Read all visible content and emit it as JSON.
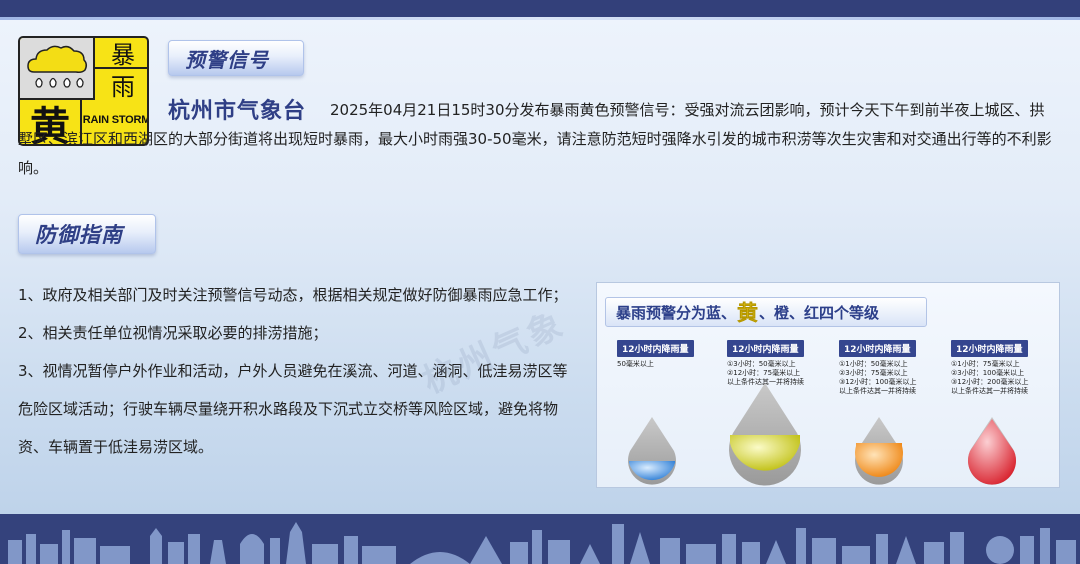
{
  "icon": {
    "cn_top": "暴",
    "cn_mid": "雨",
    "cn_level": "黄",
    "en": "RAIN STORM",
    "level_color": "#f7e316"
  },
  "warning": {
    "title": "预警信号",
    "org": "杭州市气象台",
    "text": "2025年04月21日15时30分发布暴雨黄色预警信号：受强对流云团影响，预计今天下午到前半夜上城区、拱墅区、滨江区和西湖区的大部分街道将出现短时暴雨，最大小时雨强30-50毫米，请注意防范短时强降水引发的城市积涝等次生灾害和对交通出行等的不利影响。"
  },
  "defense": {
    "title": "防御指南",
    "items": [
      "1、政府及相关部门及时关注预警信号动态，根据相关规定做好防御暴雨应急工作；",
      "2、相关责任单位视情况采取必要的排涝措施；",
      "3、视情况暂停户外作业和活动，户外人员避免在溪流、河道、涵洞、低洼易涝区等危险区域活动；行驶车辆尽量绕开积水路段及下沉式立交桥等风险区域，避免将物资、车辆置于低洼易涝区域。"
    ]
  },
  "levels": {
    "title_pre": "暴雨预警分为蓝、",
    "title_em": "黄",
    "title_post": "、橙、红四个等级",
    "watermark": "杭州气象",
    "columns": [
      {
        "head": "12小时内降雨量",
        "lines": [
          "50毫米以上"
        ],
        "color": "#2f7fd6",
        "name": "blue"
      },
      {
        "head": "12小时内降雨量",
        "lines": [
          "①3小时：50毫米以上",
          "②12小时：75毫米以上",
          "以上条件达其一并将持续"
        ],
        "color": "#e4df24",
        "name": "yellow"
      },
      {
        "head": "12小时内降雨量",
        "lines": [
          "①1小时：50毫米以上",
          "②3小时：75毫米以上",
          "③12小时：100毫米以上",
          "以上条件达其一并将持续"
        ],
        "color": "#f39a1e",
        "name": "orange"
      },
      {
        "head": "12小时内降雨量",
        "lines": [
          "①1小时：75毫米以上",
          "②3小时：100毫米以上",
          "③12小时：200毫米以上",
          "以上条件达其一并将持续"
        ],
        "color": "#e8323a",
        "name": "red"
      }
    ]
  },
  "colors": {
    "brand": "#2f3f86",
    "bar": "#33407a"
  }
}
